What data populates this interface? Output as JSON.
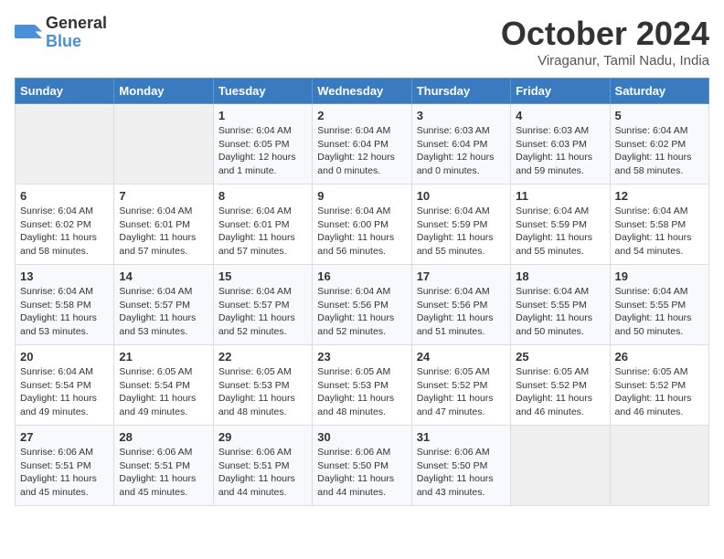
{
  "logo": {
    "line1": "General",
    "line2": "Blue"
  },
  "title": "October 2024",
  "location": "Viraganur, Tamil Nadu, India",
  "days_of_week": [
    "Sunday",
    "Monday",
    "Tuesday",
    "Wednesday",
    "Thursday",
    "Friday",
    "Saturday"
  ],
  "weeks": [
    [
      {
        "day": "",
        "content": ""
      },
      {
        "day": "",
        "content": ""
      },
      {
        "day": "1",
        "content": "Sunrise: 6:04 AM\nSunset: 6:05 PM\nDaylight: 12 hours\nand 1 minute."
      },
      {
        "day": "2",
        "content": "Sunrise: 6:04 AM\nSunset: 6:04 PM\nDaylight: 12 hours\nand 0 minutes."
      },
      {
        "day": "3",
        "content": "Sunrise: 6:03 AM\nSunset: 6:04 PM\nDaylight: 12 hours\nand 0 minutes."
      },
      {
        "day": "4",
        "content": "Sunrise: 6:03 AM\nSunset: 6:03 PM\nDaylight: 11 hours\nand 59 minutes."
      },
      {
        "day": "5",
        "content": "Sunrise: 6:04 AM\nSunset: 6:02 PM\nDaylight: 11 hours\nand 58 minutes."
      }
    ],
    [
      {
        "day": "6",
        "content": "Sunrise: 6:04 AM\nSunset: 6:02 PM\nDaylight: 11 hours\nand 58 minutes."
      },
      {
        "day": "7",
        "content": "Sunrise: 6:04 AM\nSunset: 6:01 PM\nDaylight: 11 hours\nand 57 minutes."
      },
      {
        "day": "8",
        "content": "Sunrise: 6:04 AM\nSunset: 6:01 PM\nDaylight: 11 hours\nand 57 minutes."
      },
      {
        "day": "9",
        "content": "Sunrise: 6:04 AM\nSunset: 6:00 PM\nDaylight: 11 hours\nand 56 minutes."
      },
      {
        "day": "10",
        "content": "Sunrise: 6:04 AM\nSunset: 5:59 PM\nDaylight: 11 hours\nand 55 minutes."
      },
      {
        "day": "11",
        "content": "Sunrise: 6:04 AM\nSunset: 5:59 PM\nDaylight: 11 hours\nand 55 minutes."
      },
      {
        "day": "12",
        "content": "Sunrise: 6:04 AM\nSunset: 5:58 PM\nDaylight: 11 hours\nand 54 minutes."
      }
    ],
    [
      {
        "day": "13",
        "content": "Sunrise: 6:04 AM\nSunset: 5:58 PM\nDaylight: 11 hours\nand 53 minutes."
      },
      {
        "day": "14",
        "content": "Sunrise: 6:04 AM\nSunset: 5:57 PM\nDaylight: 11 hours\nand 53 minutes."
      },
      {
        "day": "15",
        "content": "Sunrise: 6:04 AM\nSunset: 5:57 PM\nDaylight: 11 hours\nand 52 minutes."
      },
      {
        "day": "16",
        "content": "Sunrise: 6:04 AM\nSunset: 5:56 PM\nDaylight: 11 hours\nand 52 minutes."
      },
      {
        "day": "17",
        "content": "Sunrise: 6:04 AM\nSunset: 5:56 PM\nDaylight: 11 hours\nand 51 minutes."
      },
      {
        "day": "18",
        "content": "Sunrise: 6:04 AM\nSunset: 5:55 PM\nDaylight: 11 hours\nand 50 minutes."
      },
      {
        "day": "19",
        "content": "Sunrise: 6:04 AM\nSunset: 5:55 PM\nDaylight: 11 hours\nand 50 minutes."
      }
    ],
    [
      {
        "day": "20",
        "content": "Sunrise: 6:04 AM\nSunset: 5:54 PM\nDaylight: 11 hours\nand 49 minutes."
      },
      {
        "day": "21",
        "content": "Sunrise: 6:05 AM\nSunset: 5:54 PM\nDaylight: 11 hours\nand 49 minutes."
      },
      {
        "day": "22",
        "content": "Sunrise: 6:05 AM\nSunset: 5:53 PM\nDaylight: 11 hours\nand 48 minutes."
      },
      {
        "day": "23",
        "content": "Sunrise: 6:05 AM\nSunset: 5:53 PM\nDaylight: 11 hours\nand 48 minutes."
      },
      {
        "day": "24",
        "content": "Sunrise: 6:05 AM\nSunset: 5:52 PM\nDaylight: 11 hours\nand 47 minutes."
      },
      {
        "day": "25",
        "content": "Sunrise: 6:05 AM\nSunset: 5:52 PM\nDaylight: 11 hours\nand 46 minutes."
      },
      {
        "day": "26",
        "content": "Sunrise: 6:05 AM\nSunset: 5:52 PM\nDaylight: 11 hours\nand 46 minutes."
      }
    ],
    [
      {
        "day": "27",
        "content": "Sunrise: 6:06 AM\nSunset: 5:51 PM\nDaylight: 11 hours\nand 45 minutes."
      },
      {
        "day": "28",
        "content": "Sunrise: 6:06 AM\nSunset: 5:51 PM\nDaylight: 11 hours\nand 45 minutes."
      },
      {
        "day": "29",
        "content": "Sunrise: 6:06 AM\nSunset: 5:51 PM\nDaylight: 11 hours\nand 44 minutes."
      },
      {
        "day": "30",
        "content": "Sunrise: 6:06 AM\nSunset: 5:50 PM\nDaylight: 11 hours\nand 44 minutes."
      },
      {
        "day": "31",
        "content": "Sunrise: 6:06 AM\nSunset: 5:50 PM\nDaylight: 11 hours\nand 43 minutes."
      },
      {
        "day": "",
        "content": ""
      },
      {
        "day": "",
        "content": ""
      }
    ]
  ]
}
